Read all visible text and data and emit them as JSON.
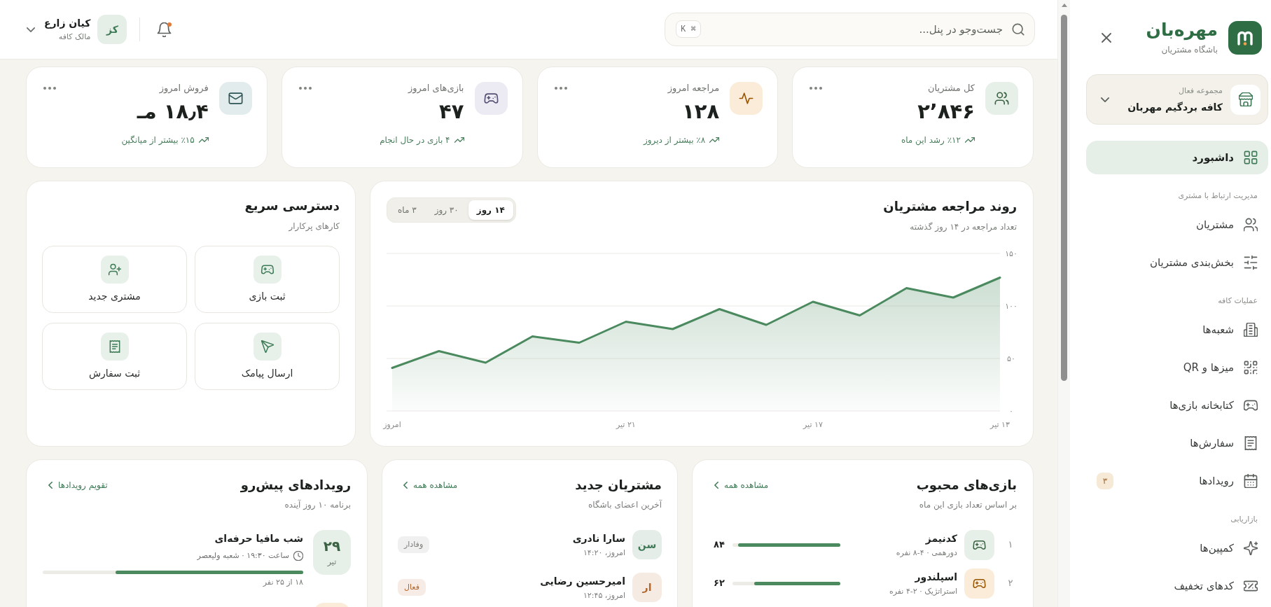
{
  "sidebar": {
    "brand": {
      "name": "مهره‌بان",
      "tagline": "باشگاه مشتریان"
    },
    "workspace": {
      "label": "مجموعه فعال",
      "value": "کافه بردگیم مهربان"
    },
    "nav": [
      {
        "items": [
          {
            "label": "داشبورد",
            "selected": true
          }
        ]
      },
      {
        "heading": "مدیریت ارتباط با مشتری",
        "items": [
          {
            "label": "مشتریان",
            "selected": false
          },
          {
            "label": "بخش‌بندی مشتریان",
            "selected": false
          }
        ]
      },
      {
        "heading": "عملیات کافه",
        "items": [
          {
            "label": "شعبه‌ها",
            "selected": false
          },
          {
            "label": "میزها و QR",
            "selected": false
          },
          {
            "label": "کتابخانه بازی‌ها",
            "selected": false
          },
          {
            "label": "سفارش‌ها",
            "selected": false
          },
          {
            "label": "رویدادها",
            "selected": false,
            "badge": "۳"
          }
        ]
      },
      {
        "heading": "بازاریابی",
        "items": [
          {
            "label": "کمپین‌ها",
            "selected": false
          },
          {
            "label": "کدهای تخفیف",
            "selected": false
          }
        ]
      }
    ]
  },
  "topbar": {
    "search": {
      "placeholder": "جست‌وجو در پنل...",
      "shortcut": "⌘ K"
    },
    "notifications": {
      "unread": true
    },
    "user": {
      "initials": "کز",
      "name": "کیان زارع",
      "role": "مالک کافه"
    }
  },
  "stats": [
    {
      "label": "کل مشتریان",
      "value": "۲٬۸۴۶",
      "trend": "٪۱۲ رشد این ماه",
      "color": "#e6efe8"
    },
    {
      "label": "مراجعه امروز",
      "value": "۱۲۸",
      "trend": "٪۸ بیشتر از دیروز",
      "color": "#fbecd9"
    },
    {
      "label": "بازی‌های امروز",
      "value": "۴۷",
      "trend": "۴ بازی در حال انجام",
      "color": "#ecebf3"
    },
    {
      "label": "فروش امروز",
      "value": "۱۸٫۴ مـ",
      "trend": "٪۱۵ بیشتر از میانگین",
      "color": "#e3ecec"
    }
  ],
  "visits_chart": {
    "title": "روند مراجعه مشتریان",
    "subtitle": "تعداد مراجعه در ۱۴ روز گذشته",
    "ranges": [
      {
        "label": "۱۴ روز",
        "selected": true
      },
      {
        "label": "۳۰ روز",
        "selected": false
      },
      {
        "label": "۳ ماه",
        "selected": false
      }
    ],
    "chart_data": {
      "type": "area",
      "categories": [
        "امروز",
        null,
        null,
        null,
        null,
        "۲۱ تیر",
        null,
        null,
        null,
        "۱۷ تیر",
        null,
        null,
        null,
        "۱۳ تیر"
      ],
      "ylim": [
        0,
        150
      ],
      "yticks": [
        {
          "value": 0,
          "label": "۰"
        },
        {
          "value": 50,
          "label": "۵۰"
        },
        {
          "value": 100,
          "label": "۱۰۰"
        },
        {
          "value": 150,
          "label": "۱۵۰"
        }
      ],
      "series": [
        {
          "color": "#4a8a5e",
          "values": [
            41,
            57,
            46,
            71,
            65,
            85,
            78,
            97,
            82,
            104,
            91,
            117,
            108,
            127
          ]
        }
      ]
    }
  },
  "quick_access": {
    "title": "دسترسی سریع",
    "subtitle": "کارهای پرکارار",
    "actions": [
      {
        "label": "ثبت بازی"
      },
      {
        "label": "مشتری جدید"
      },
      {
        "label": "ارسال پیامک"
      },
      {
        "label": "ثبت سفارش"
      }
    ]
  },
  "popular_games": {
    "title": "بازی‌های محبوب",
    "subtitle": "بر اساس تعداد بازی این ماه",
    "link": "مشاهده همه",
    "rows": [
      {
        "rank": "۱",
        "name": "کدنیمز",
        "meta": "دورهمی · ۴-۸ نفره",
        "count": "۸۴",
        "level": 0.95,
        "color": "#e6efe8"
      },
      {
        "rank": "۲",
        "name": "اسپلندور",
        "meta": "استراتژیک · ۲-۴ نفره",
        "count": "۶۲",
        "level": 0.8,
        "color": "#fbecd9"
      }
    ]
  },
  "new_customers": {
    "title": "مشتریان جدید",
    "subtitle": "آخرین اعضای باشگاه",
    "link": "مشاهده همه",
    "rows": [
      {
        "initials": "سن",
        "name": "سارا نادری",
        "time": "امروز، ۱۴:۲۰",
        "color": "#3d7a55",
        "badge": {
          "label": "وفادار",
          "color": "#7d817c"
        }
      },
      {
        "initials": "ار",
        "name": "امیرحسین رضایی",
        "time": "امروز، ۱۲:۴۵",
        "color": "#b3662c",
        "badge": {
          "label": "فعال",
          "color": "#b3662c"
        }
      }
    ]
  },
  "events": {
    "title": "رویدادهای پیش‌رو",
    "subtitle": "برنامه ۱۰ روز آینده",
    "link": "تقویم رویدادها",
    "items": [
      {
        "day": "۲۹",
        "month": "تیر",
        "title": "شب مافیا حرفه‌ای",
        "meta": "ساعت ۱۹:۳۰ · شعبه ولیعصر",
        "level": 0.72,
        "capacity": "۱۸ از ۲۵ نفر",
        "color": "#e6efe8"
      },
      {
        "color": "#fbecd9"
      }
    ]
  }
}
